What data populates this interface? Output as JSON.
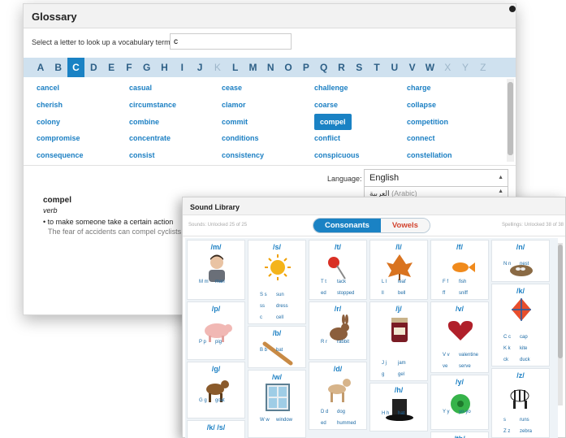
{
  "glossary": {
    "title": "Glossary",
    "search_label": "Select a letter to look up a vocabulary term or:",
    "search_value": "c",
    "letters": [
      {
        "char": "A",
        "state": "normal"
      },
      {
        "char": "B",
        "state": "normal"
      },
      {
        "char": "C",
        "state": "active"
      },
      {
        "char": "D",
        "state": "normal"
      },
      {
        "char": "E",
        "state": "normal"
      },
      {
        "char": "F",
        "state": "normal"
      },
      {
        "char": "G",
        "state": "normal"
      },
      {
        "char": "H",
        "state": "normal"
      },
      {
        "char": "I",
        "state": "normal"
      },
      {
        "char": "J",
        "state": "normal"
      },
      {
        "char": "K",
        "state": "disabled"
      },
      {
        "char": "L",
        "state": "normal"
      },
      {
        "char": "M",
        "state": "normal"
      },
      {
        "char": "N",
        "state": "normal"
      },
      {
        "char": "O",
        "state": "normal"
      },
      {
        "char": "P",
        "state": "normal"
      },
      {
        "char": "Q",
        "state": "normal"
      },
      {
        "char": "R",
        "state": "normal"
      },
      {
        "char": "S",
        "state": "normal"
      },
      {
        "char": "T",
        "state": "normal"
      },
      {
        "char": "U",
        "state": "normal"
      },
      {
        "char": "V",
        "state": "normal"
      },
      {
        "char": "W",
        "state": "normal"
      },
      {
        "char": "X",
        "state": "disabled"
      },
      {
        "char": "Y",
        "state": "disabled"
      },
      {
        "char": "Z",
        "state": "disabled"
      }
    ],
    "terms": [
      "cancel",
      "casual",
      "cease",
      "challenge",
      "charge",
      "cherish",
      "circumstance",
      "clamor",
      "coarse",
      "collapse",
      "colony",
      "combine",
      "commit",
      "compel",
      "competition",
      "compromise",
      "concentrate",
      "conditions",
      "conflict",
      "connect",
      "consequence",
      "consist",
      "consistency",
      "conspicuous",
      "constellation"
    ],
    "selected_term": "compel",
    "language_label": "Language:",
    "language_value": "English",
    "language_option_native": "العربية",
    "language_option_english": "(Arabic)",
    "definition": {
      "word": "compel",
      "part_of_speech": "verb",
      "text": "• to make someone take a certain action",
      "example": "The fear of accidents can compel cyclists t"
    }
  },
  "sound_library": {
    "title": "Sound Library",
    "sounds_status": "Sounds: Unlocked 25 of 25",
    "spellings_status": "Spellings: Unlocked 38 of 38",
    "tab_consonants": "Consonants",
    "tab_vowels": "Vowels",
    "columns": [
      [
        {
          "sound": "/m/",
          "icon": "boy-icon",
          "r1": [
            "M m",
            "man"
          ],
          "r2": [
            "",
            ""
          ]
        },
        {
          "sound": "/p/",
          "icon": "pig-icon",
          "r1": [
            "P p",
            "pig"
          ],
          "r2": [
            "",
            ""
          ]
        },
        {
          "sound": "/g/",
          "icon": "goat-icon",
          "r1": [
            "G g",
            "goat"
          ],
          "r2": [
            "",
            ""
          ]
        },
        {
          "sound": "/k/ /s/",
          "icon": "hands-icon",
          "r1": [
            "",
            ""
          ],
          "r2": [
            "",
            ""
          ]
        }
      ],
      [
        {
          "sound": "/s/",
          "icon": "sun-icon",
          "r1": [
            "S s",
            "sun"
          ],
          "r2": [
            "ss",
            "dress"
          ],
          "r3": [
            "c",
            "cell"
          ]
        },
        {
          "sound": "/b/",
          "icon": "bat-icon",
          "r1": [
            "B b",
            "bat"
          ],
          "r2": [
            "",
            ""
          ]
        },
        {
          "sound": "/w/",
          "icon": "window-icon",
          "r1": [
            "W w",
            "window"
          ],
          "r2": [
            "",
            ""
          ]
        }
      ],
      [
        {
          "sound": "/t/",
          "icon": "tack-icon",
          "r1": [
            "T t",
            "tack"
          ],
          "r2": [
            "ed",
            "stopped"
          ]
        },
        {
          "sound": "/r/",
          "icon": "rabbit-icon",
          "r1": [
            "R r",
            "rabbit"
          ],
          "r2": [
            "",
            ""
          ]
        },
        {
          "sound": "/d/",
          "icon": "dog-icon",
          "r1": [
            "D d",
            "dog"
          ],
          "r2": [
            "ed",
            "hummed"
          ]
        }
      ],
      [
        {
          "sound": "/l/",
          "icon": "leaf-icon",
          "r1": [
            "L l",
            "leaf"
          ],
          "r2": [
            "ll",
            "bell"
          ]
        },
        {
          "sound": "/j/",
          "icon": "jam-icon",
          "r1": [
            "J j",
            "jam"
          ],
          "r2": [
            "g",
            "gel"
          ]
        },
        {
          "sound": "/h/",
          "icon": "hat-icon",
          "r1": [
            "H h",
            "hat"
          ],
          "r2": [
            "",
            ""
          ]
        }
      ],
      [
        {
          "sound": "/f/",
          "icon": "fish-icon",
          "r1": [
            "F f",
            "fish"
          ],
          "r2": [
            "ff",
            "sniff"
          ]
        },
        {
          "sound": "/v/",
          "icon": "valentine-icon",
          "r1": [
            "V v",
            "valentine"
          ],
          "r2": [
            "ve",
            "serve"
          ]
        },
        {
          "sound": "/y/",
          "icon": "yoyo-icon",
          "r1": [
            "Y y",
            "yo-yo"
          ],
          "r2": [
            "",
            ""
          ]
        },
        {
          "sound": "/th/",
          "icon": "blank-icon",
          "r1": [
            "",
            ""
          ],
          "r2": [
            "",
            ""
          ]
        }
      ],
      [
        {
          "sound": "/n/",
          "icon": "nest-icon",
          "r1": [
            "N n",
            "nest"
          ],
          "r2": [
            "",
            ""
          ]
        },
        {
          "sound": "/k/",
          "icon": "kite-icon",
          "r1": [
            "C c",
            "cap"
          ],
          "r2": [
            "K k",
            "kite"
          ],
          "r3": [
            "ck",
            "duck"
          ]
        },
        {
          "sound": "/z/",
          "icon": "zebra-icon",
          "r1": [
            "s",
            "runs"
          ],
          "r2": [
            "Z z",
            "zebra"
          ]
        }
      ]
    ]
  }
}
